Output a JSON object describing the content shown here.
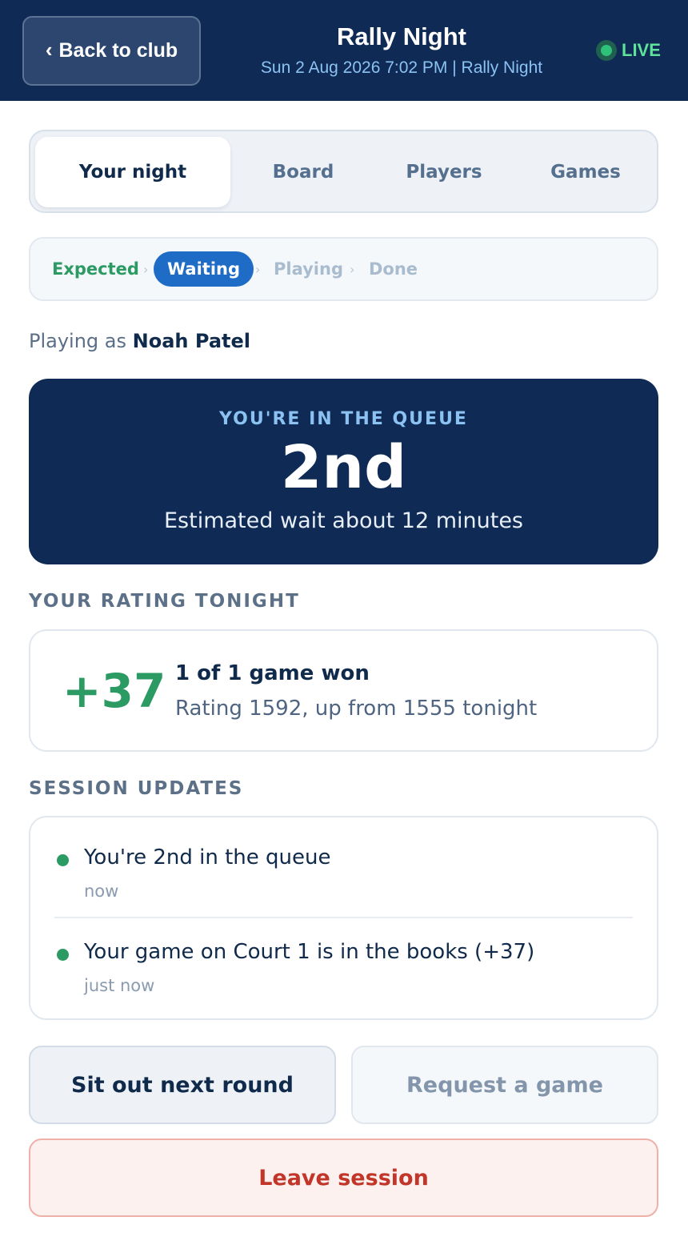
{
  "header": {
    "back_label": "Back to club",
    "title": "Rally Night",
    "subtitle": "Sun 2 Aug 2026 7:02 PM | Rally Night",
    "live_label": "LIVE"
  },
  "tabs": [
    {
      "label": "Your night",
      "active": true
    },
    {
      "label": "Board",
      "active": false
    },
    {
      "label": "Players",
      "active": false
    },
    {
      "label": "Games",
      "active": false
    }
  ],
  "stepper": [
    {
      "label": "Expected",
      "state": "done"
    },
    {
      "label": "Waiting",
      "state": "current"
    },
    {
      "label": "Playing",
      "state": "future"
    },
    {
      "label": "Done",
      "state": "future"
    }
  ],
  "player": {
    "prefix": "Playing as",
    "name": "Noah Patel"
  },
  "queue": {
    "label": "YOU'RE IN THE QUEUE",
    "position": "2nd",
    "wait": "Estimated wait about 12 minutes"
  },
  "rating": {
    "section_title": "YOUR RATING TONIGHT",
    "delta": "+37",
    "summary": "1 of 1 game won",
    "detail": "Rating 1592, up from 1555 tonight"
  },
  "updates": {
    "section_title": "SESSION UPDATES",
    "items": [
      {
        "message": "You're 2nd in the queue",
        "time": "now"
      },
      {
        "message": "Your game on Court 1 is in the books (+37)",
        "time": "just now"
      }
    ]
  },
  "actions": {
    "sit_out": "Sit out next round",
    "request_game": "Request a game",
    "leave": "Leave session"
  },
  "colors": {
    "navy": "#0e2a55",
    "accent_blue": "#1f6cc6",
    "success_green": "#2b9a63",
    "live_green": "#5fe39a",
    "danger_red": "#c2362a"
  },
  "icons": {
    "back": "chevron-left-icon",
    "live": "live-dot-icon",
    "update": "status-dot-icon",
    "step_separator": "chevron-right-icon"
  }
}
